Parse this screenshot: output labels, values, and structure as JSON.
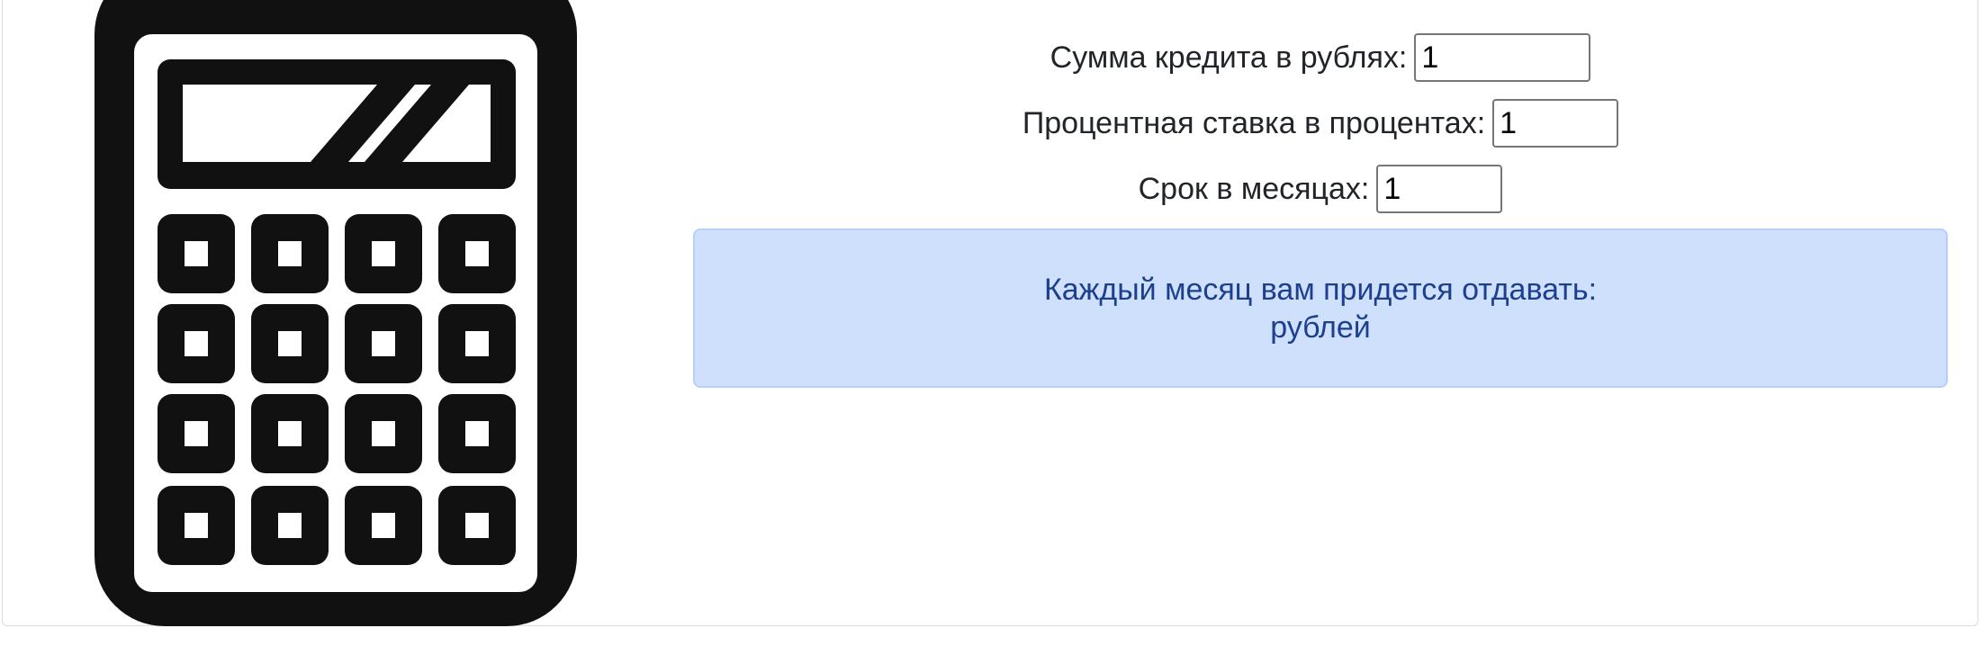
{
  "icons": {
    "calculator": "calculator-icon"
  },
  "form": {
    "sum": {
      "label": "Сумма кредита в рублях:",
      "value": "1"
    },
    "rate": {
      "label": "Процентная ставка в процентах:",
      "value": "1"
    },
    "term": {
      "label": "Срок в месяцах:",
      "value": "1"
    }
  },
  "result": {
    "title": "Каждый месяц вам придется отдавать:",
    "amount": "",
    "unit": "рублей"
  },
  "colors": {
    "result_background": "#cfe0fc",
    "result_border": "#b6d0fb",
    "result_text": "#1d3f8f",
    "icon": "#111111"
  }
}
